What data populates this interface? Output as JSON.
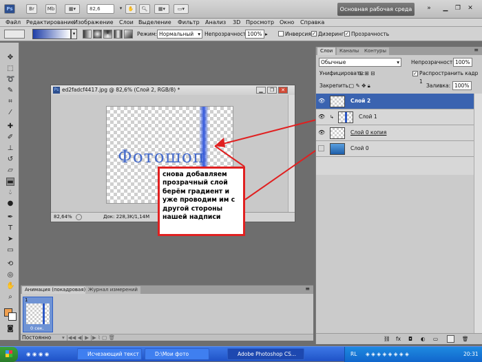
{
  "appbar": {
    "ps_logo": "Ps",
    "br_label": "Br",
    "mb_label": "Mb",
    "zoom": "82,6",
    "workspace": "Основная рабочая среда",
    "icons": [
      "bridge-icon",
      "mini-bridge-icon",
      "view-extras-icon",
      "zoom-select-icon",
      "hand-icon",
      "arrange-documents-icon",
      "screen-mode-icon"
    ]
  },
  "menu": {
    "items": [
      "Файл",
      "Редактирование",
      "Изображение",
      "Слои",
      "Выделение",
      "Фильтр",
      "Анализ",
      "3D",
      "Просмотр",
      "Окно",
      "Справка"
    ]
  },
  "options": {
    "mode_label": "Режим:",
    "mode_value": "Нормальный",
    "opacity_label": "Непрозрачность:",
    "opacity_value": "100%",
    "inverse_label": "Инверсия",
    "dither_label": "Дизеринг",
    "transparency_label": "Прозрачность"
  },
  "document": {
    "title": "ed2fadcf4417.jpg @ 82,6% (Слой 2, RGB/8) *",
    "canvas_text": "Фотошоп",
    "zoom": "82,64%",
    "doc_info": "Док: 228,3K/1,14M"
  },
  "note": {
    "text": "снова  добавляем прозрачный слой берём градиент и уже проводим им с другой стороны нашей надписи"
  },
  "layers_panel": {
    "tabs": [
      "Слои",
      "Каналы",
      "Контуры"
    ],
    "blend_mode": "Обычные",
    "opacity_label": "Непрозрачность:",
    "opacity_value": "100%",
    "unify_label": "Унифицировать:",
    "propagate_label": "Распространить кадр 1",
    "lock_label": "Закрепить:",
    "fill_label": "Заливка:",
    "fill_value": "100%",
    "layers": [
      {
        "name": "Слой 2"
      },
      {
        "name": "Слой 1"
      },
      {
        "name": "Слой 0 копия"
      },
      {
        "name": "Слой 0"
      }
    ]
  },
  "animation_panel": {
    "tabs": [
      "Анимация (покадровая)",
      "Журнал измерений"
    ],
    "frame_number": "1",
    "frame_time": "0 сек.",
    "loop_value": "Постоянно"
  },
  "taskbar": {
    "tasks": [
      "Исчезающий текст ...",
      "D:\\Мои фото",
      "Adobe Photoshop CS..."
    ],
    "lang": "RL",
    "clock": "20:31"
  },
  "colors": {
    "accent_red": "#e02020",
    "selected_layer": "#3a63b0",
    "text_blue": "#2a56c6"
  }
}
